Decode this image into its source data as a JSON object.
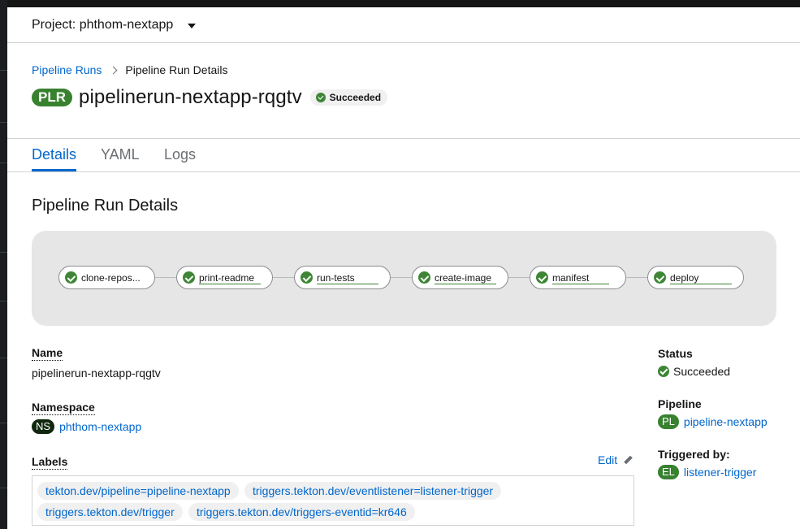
{
  "project": {
    "label": "Project: phthom-nextapp"
  },
  "breadcrumb": {
    "parent": "Pipeline Runs",
    "current": "Pipeline Run Details"
  },
  "header": {
    "badge": "PLR",
    "title": "pipelinerun-nextapp-rqgtv",
    "status": "Succeeded"
  },
  "tabs": [
    {
      "label": "Details",
      "active": true
    },
    {
      "label": "YAML"
    },
    {
      "label": "Logs"
    }
  ],
  "section": {
    "title": "Pipeline Run Details"
  },
  "topology": {
    "tasks": [
      {
        "label": "clone-repos...",
        "status": "succeeded"
      },
      {
        "label": "print-readme",
        "status": "succeeded"
      },
      {
        "label": "run-tests",
        "status": "succeeded"
      },
      {
        "label": "create-image",
        "status": "succeeded"
      },
      {
        "label": "manifest",
        "status": "succeeded"
      },
      {
        "label": "deploy",
        "status": "succeeded"
      }
    ]
  },
  "details": {
    "name_label": "Name",
    "name_value": "pipelinerun-nextapp-rqgtv",
    "namespace_label": "Namespace",
    "namespace_badge": "NS",
    "namespace_value": "phthom-nextapp",
    "labels_label": "Labels",
    "edit_label": "Edit",
    "labels": [
      "tekton.dev/pipeline=pipeline-nextapp",
      "triggers.tekton.dev/eventlistener=listener-trigger",
      "triggers.tekton.dev/trigger",
      "triggers.tekton.dev/triggers-eventid=kr646"
    ],
    "status_label": "Status",
    "status_value": "Succeeded",
    "pipeline_label": "Pipeline",
    "pipeline_badge": "PL",
    "pipeline_value": "pipeline-nextapp",
    "triggered_label": "Triggered by:",
    "triggered_badge": "EL",
    "triggered_value": "listener-trigger"
  },
  "colors": {
    "link": "#0066cc",
    "success": "#3e8635",
    "badge_green": "#38812f"
  },
  "icons": {
    "success": "check-circle-icon",
    "edit": "pencil-icon",
    "caret": "caret-down-icon"
  }
}
